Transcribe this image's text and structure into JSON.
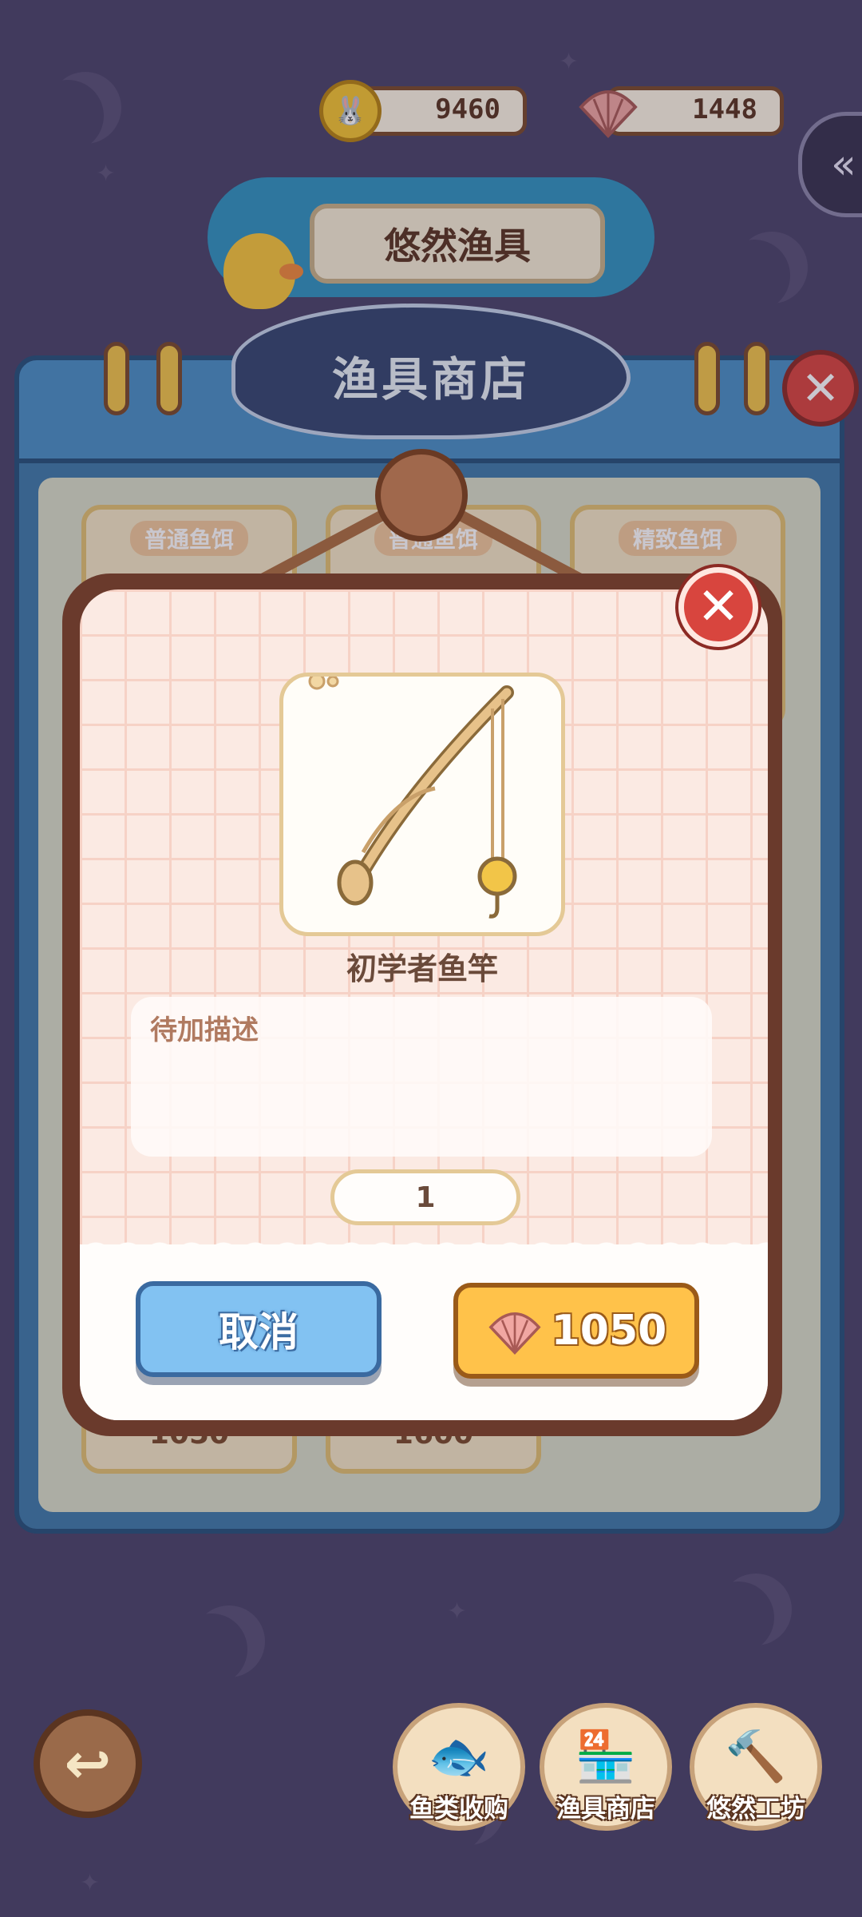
{
  "currency": {
    "coins": "9460",
    "shells": "1448"
  },
  "banner": {
    "title": "悠然渔具"
  },
  "shop": {
    "title": "渔具商店",
    "tabs": [
      "普通鱼饵",
      "普通鱼饵",
      "精致鱼饵"
    ],
    "visible_prices": [
      "1050",
      "1600"
    ]
  },
  "modal": {
    "item_name": "初学者鱼竿",
    "description": "待加描述",
    "quantity": "1",
    "cancel_label": "取消",
    "buy_price": "1050"
  },
  "nav": {
    "items": [
      {
        "label": "鱼类收购",
        "icon": "fish-jar-icon"
      },
      {
        "label": "渔具商店",
        "icon": "shop-stall-icon"
      },
      {
        "label": "悠然工坊",
        "icon": "workshop-tools-icon"
      }
    ]
  },
  "colors": {
    "background": "#4a4368",
    "close_red": "#d8453e",
    "cancel_blue": "#82c2f2",
    "buy_orange": "#ffc24a"
  }
}
